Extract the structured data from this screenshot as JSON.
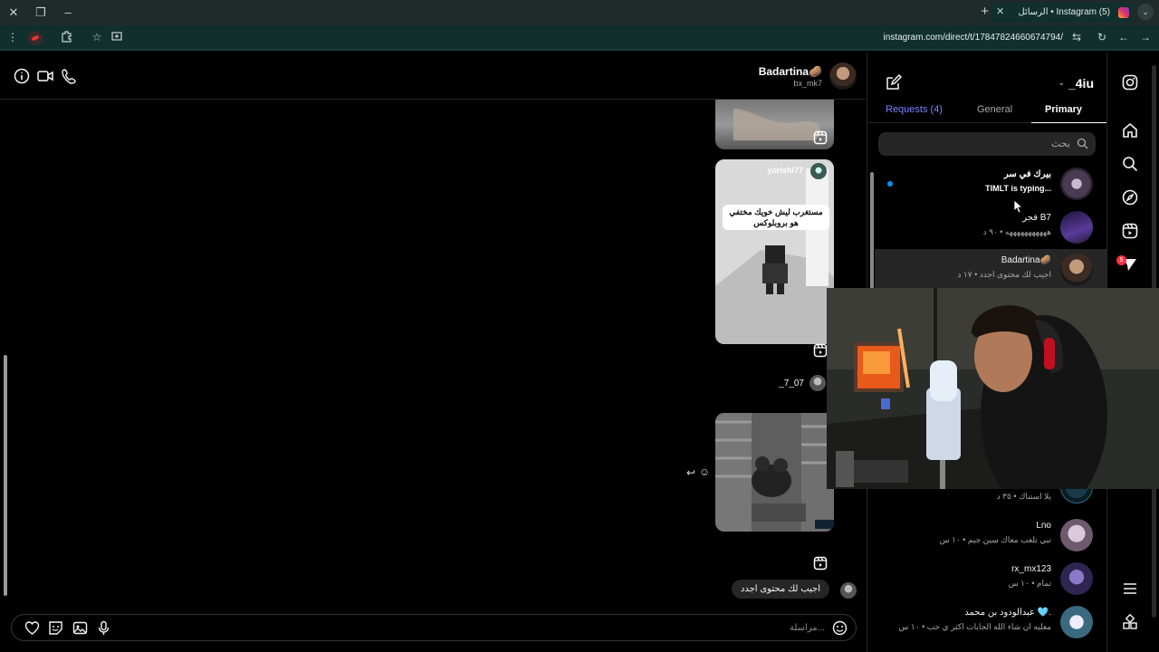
{
  "browser": {
    "tab_title": "الرسائل • Instagram (5)",
    "url": "instagram.com/direct/t/17847824660674794/"
  },
  "chat": {
    "peer_name": "Badartina🥔",
    "peer_username": "bx_mk7",
    "reel1_sender": "yorishi77",
    "reel1_overlay_line1": "مستغرب ليش خويك مختفي",
    "reel1_overlay_line2": "هو بروبلوكس",
    "sender2_name": "_7_07",
    "last_message": "اجيب لك محتوى اجدد",
    "composer_placeholder": "مراسلة..."
  },
  "inbox": {
    "username": "_4iu",
    "tabs": {
      "primary": "Primary",
      "general": "General",
      "requests": "Requests (4)"
    },
    "search_placeholder": "بحث",
    "conversations": [
      {
        "name": "بيرك في سر",
        "preview": "TIMLT is typing...",
        "unread": true
      },
      {
        "name": "فجر B7",
        "preview": "هههههههههههه • ٩٠ د"
      },
      {
        "name": "Badartina🥔",
        "preview": "اجيب لك محتوى اجدد • ١٧ د",
        "active": true
      },
      {
        "name": "",
        "preview": "يلا استناك • ٣٥ د"
      },
      {
        "name": "Lno",
        "preview": "تبي تلعب معاك سين جيم • ١٠ س"
      },
      {
        "name": "rx_mx123",
        "preview": "تمام • ١٠ س"
      },
      {
        "name": "عبدالودود بن محمد 🩵.",
        "preview": "معليه ان شاء الله الجايات اكثر ي حب • ١٠ س"
      }
    ]
  },
  "rail": {
    "notification_badge": "5"
  },
  "colors": {
    "accent_blue": "#0095f6",
    "requests_link": "#7c83ff",
    "badge_red": "#ff3040",
    "browser_chrome": "#11302d"
  }
}
